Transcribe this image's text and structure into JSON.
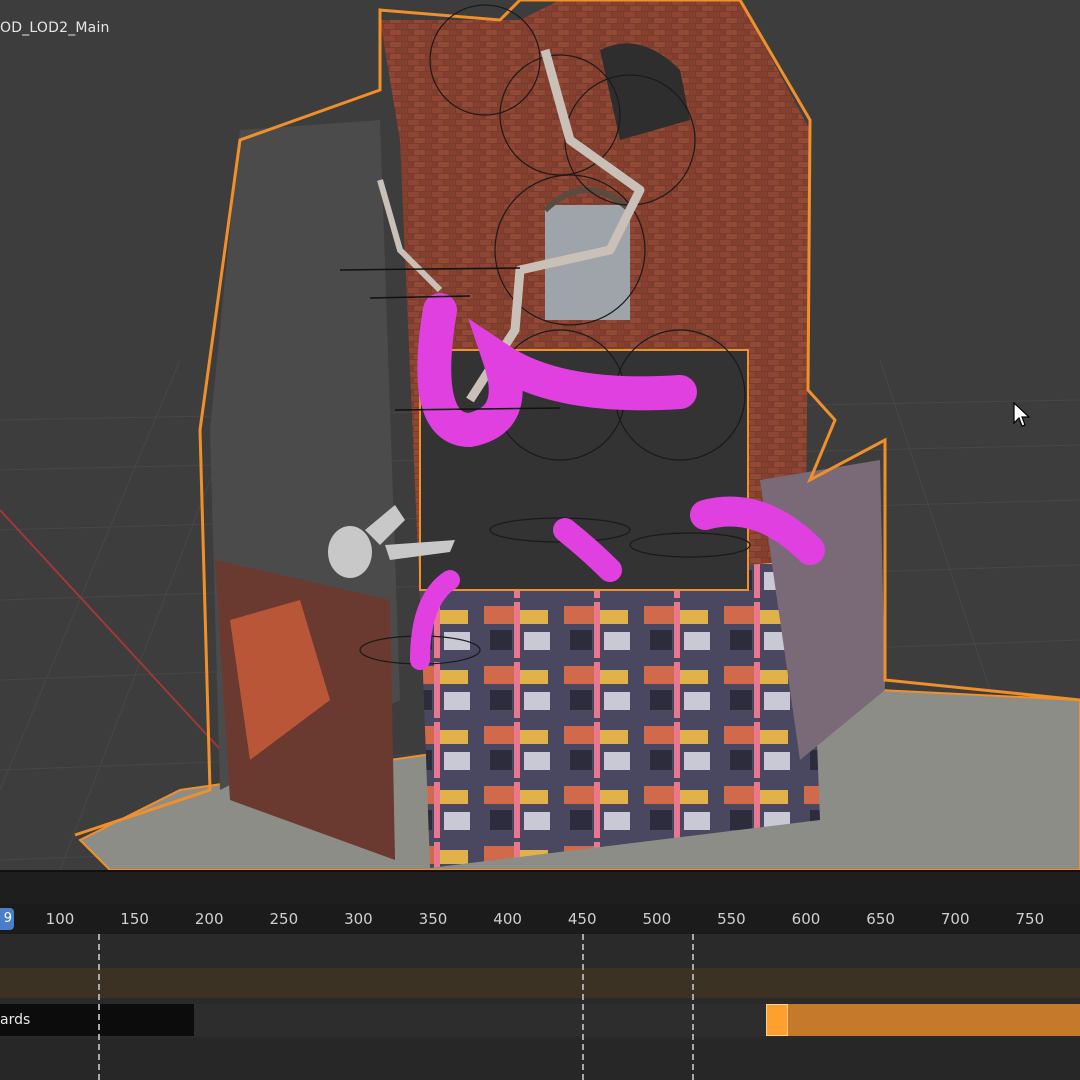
{
  "viewport": {
    "object_name": "OD_LOD2_Main"
  },
  "timeline": {
    "current_frame": "9",
    "ruler_ticks": [
      "100",
      "150",
      "200",
      "250",
      "300",
      "350",
      "400",
      "450",
      "500",
      "550",
      "600",
      "650",
      "700",
      "750"
    ],
    "track_label": "ards"
  },
  "icons": {
    "cursor": "mouse-pointer-icon",
    "armature": "armature-bones-icon"
  },
  "colors": {
    "selection_outline": "#f0902a",
    "tentacle": "#e040e0",
    "strip": "#c47a2b",
    "current_frame": "#4a7fc8"
  }
}
